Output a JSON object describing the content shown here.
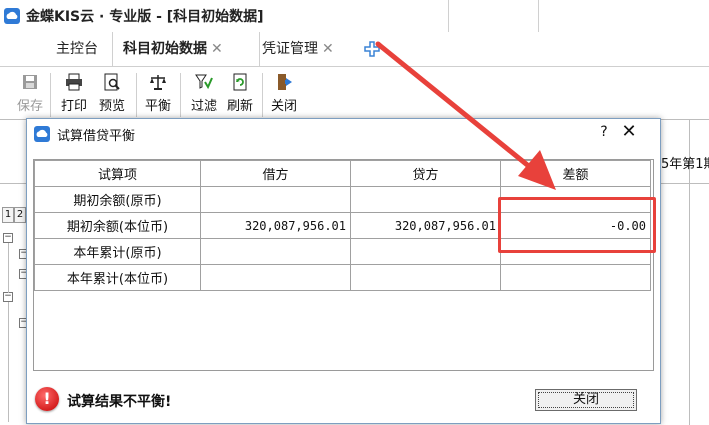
{
  "app": {
    "title": "金蝶KIS云 · 专业版 - [科目初始数据]"
  },
  "tabs": [
    {
      "label": "主控台",
      "closable": false
    },
    {
      "label": "科目初始数据",
      "closable": true,
      "active": true
    },
    {
      "label": "凭证管理",
      "closable": true
    }
  ],
  "toolbar": {
    "save": "保存",
    "print": "打印",
    "preview": "预览",
    "balance": "平衡",
    "filter": "过滤",
    "refresh": "刷新",
    "close": "关闭"
  },
  "background": {
    "period_text": "5年第1期",
    "sheet_tabs": [
      "1",
      "2"
    ]
  },
  "dialog": {
    "title": "试算借贷平衡",
    "help": "?",
    "close": "✕",
    "columns": [
      "试算项",
      "借方",
      "贷方",
      "差额"
    ],
    "rows": [
      {
        "item": "期初余额(原币)",
        "debit": "",
        "credit": "",
        "diff": ""
      },
      {
        "item": "期初余额(本位币)",
        "debit": "320,087,956.01",
        "credit": "320,087,956.01",
        "diff": "-0.00"
      },
      {
        "item": "本年累计(原币)",
        "debit": "",
        "credit": "",
        "diff": ""
      },
      {
        "item": "本年累计(本位币)",
        "debit": "",
        "credit": "",
        "diff": ""
      }
    ],
    "result_text": "试算结果不平衡!",
    "close_button": "关闭"
  },
  "colors": {
    "annotation": "#e8413b",
    "accent": "#2f7ad6"
  }
}
